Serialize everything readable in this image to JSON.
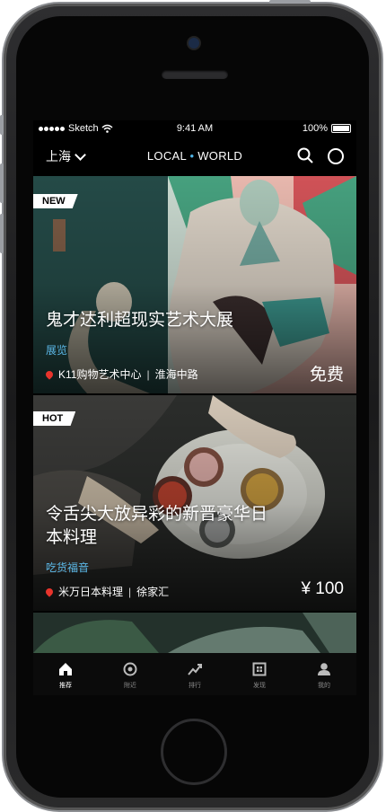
{
  "status_bar": {
    "carrier": "Sketch",
    "time": "9:41 AM",
    "battery": "100%"
  },
  "nav": {
    "city": "上海",
    "brand_local": "LOCAL",
    "brand_dot": "•",
    "brand_world": "WORLD"
  },
  "cards": [
    {
      "tag": "NEW",
      "title": "鬼才达利超现实艺术大展",
      "category": "展览",
      "venue": "K11购物艺术中心",
      "separator": "|",
      "area": "淮海中路",
      "price": "免费"
    },
    {
      "tag": "HOT",
      "title": "令舌尖大放异彩的新晋豪华日本料理",
      "category": "吃货福音",
      "venue": "米万日本料理",
      "separator": "|",
      "area": "徐家汇",
      "price": "¥ 100"
    }
  ],
  "tabs": [
    {
      "label": "推荐",
      "icon": "home-icon"
    },
    {
      "label": "附近",
      "icon": "nearby-icon"
    },
    {
      "label": "排行",
      "icon": "trend-icon"
    },
    {
      "label": "发现",
      "icon": "discover-icon"
    },
    {
      "label": "我的",
      "icon": "profile-icon"
    }
  ],
  "colors": {
    "accent": "#5bb7e6",
    "pin": "#e8342c",
    "background": "#000000"
  }
}
